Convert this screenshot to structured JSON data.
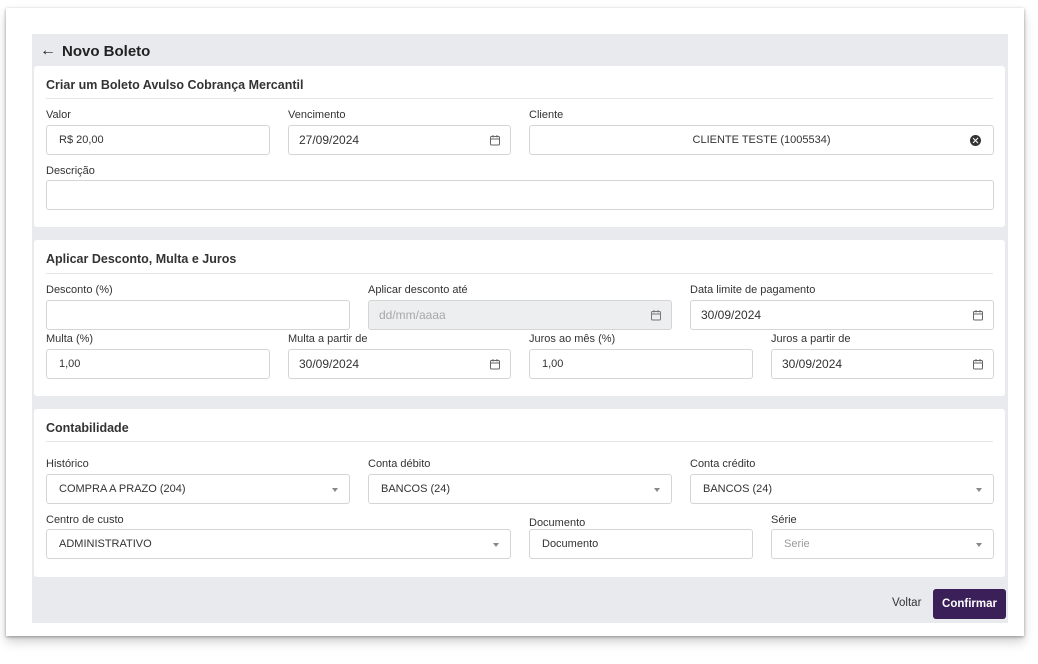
{
  "header": {
    "back_icon": "arrow-left-icon",
    "title": "Novo Boleto"
  },
  "section1": {
    "title": "Criar um Boleto Avulso Cobrança Mercantil",
    "valor": {
      "label": "Valor",
      "value": "R$ 20,00"
    },
    "vencimento": {
      "label": "Vencimento",
      "value": "27/09/2024"
    },
    "cliente": {
      "label": "Cliente",
      "value": "CLIENTE TESTE (1005534)"
    },
    "descricao": {
      "label": "Descrição",
      "value": ""
    }
  },
  "section2": {
    "title": "Aplicar Desconto, Multa e Juros",
    "desconto": {
      "label": "Desconto (%)",
      "value": ""
    },
    "aplicar_desconto_ate": {
      "label": "Aplicar desconto até",
      "placeholder": "dd/mm/aaaa"
    },
    "data_limite": {
      "label": "Data limite de pagamento",
      "value": "30/09/2024"
    },
    "multa": {
      "label": "Multa (%)",
      "value": "1,00"
    },
    "multa_a_partir": {
      "label": "Multa a partir de",
      "value": "30/09/2024"
    },
    "juros_mes": {
      "label": "Juros ao mês (%)",
      "value": "1,00"
    },
    "juros_a_partir": {
      "label": "Juros a partir de",
      "value": "30/09/2024"
    }
  },
  "section3": {
    "title": "Contabilidade",
    "historico": {
      "label": "Histórico",
      "value": "COMPRA A PRAZO (204)"
    },
    "conta_debito": {
      "label": "Conta débito",
      "value": "BANCOS (24)"
    },
    "conta_credito": {
      "label": "Conta crédito",
      "value": "BANCOS (24)"
    },
    "centro_custo": {
      "label": "Centro de custo",
      "value": "ADMINISTRATIVO"
    },
    "documento": {
      "label": "Documento",
      "value": "Documento"
    },
    "serie": {
      "label": "Série",
      "placeholder": "Serie"
    }
  },
  "footer": {
    "back_label": "Voltar",
    "confirm_label": "Confirmar"
  },
  "colors": {
    "primary": "#3b1f59",
    "background": "#e8eaee"
  }
}
